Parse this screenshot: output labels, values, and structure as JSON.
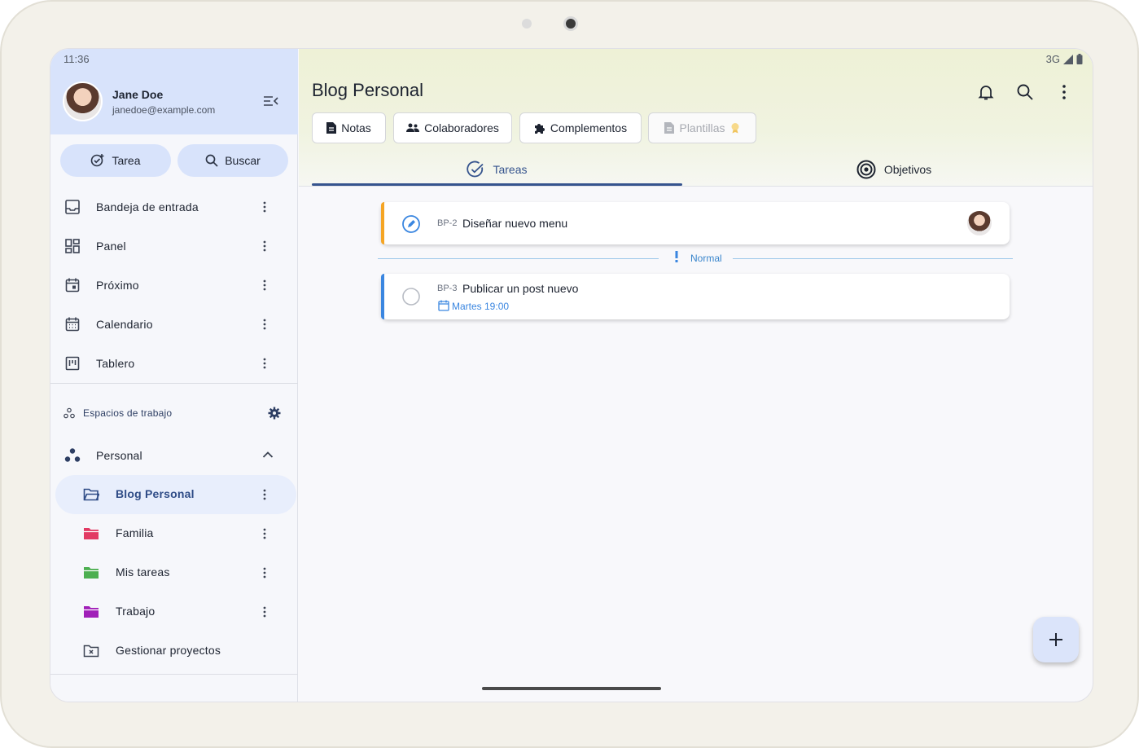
{
  "status": {
    "time": "11:36",
    "network": "3G"
  },
  "user": {
    "name": "Jane Doe",
    "email": "janedoe@example.com"
  },
  "actions": {
    "task_label": "Tarea",
    "search_label": "Buscar"
  },
  "nav": [
    {
      "label": "Bandeja de entrada",
      "icon": "inbox-icon"
    },
    {
      "label": "Panel",
      "icon": "dashboard-icon"
    },
    {
      "label": "Próximo",
      "icon": "calendar-today-icon"
    },
    {
      "label": "Calendario",
      "icon": "calendar-month-icon"
    },
    {
      "label": "Tablero",
      "icon": "board-icon"
    }
  ],
  "workspaces": {
    "header": "Espacios de trabajo",
    "group": "Personal",
    "items": [
      {
        "label": "Blog Personal",
        "color": "#2e4b86",
        "active": true
      },
      {
        "label": "Familia",
        "color": "#e23a63"
      },
      {
        "label": "Mis tareas",
        "color": "#4caf50"
      },
      {
        "label": "Trabajo",
        "color": "#a01fb8"
      }
    ],
    "manage": "Gestionar proyectos"
  },
  "main": {
    "title": "Blog Personal",
    "chips": [
      {
        "label": "Notas",
        "icon": "document-icon"
      },
      {
        "label": "Colaboradores",
        "icon": "people-icon"
      },
      {
        "label": "Complementos",
        "icon": "puzzle-icon"
      },
      {
        "label": "Plantillas",
        "icon": "template-icon",
        "disabled": true
      }
    ],
    "tabs": [
      {
        "label": "Tareas",
        "active": true
      },
      {
        "label": "Objetivos"
      }
    ],
    "tasks_in_progress": [
      {
        "code": "BP-2",
        "title": "Diseñar nuevo menu",
        "accent": "#f5a524"
      }
    ],
    "group_label": "Normal",
    "tasks_normal": [
      {
        "code": "BP-3",
        "title": "Publicar un post nuevo",
        "due": "Martes 19:00",
        "accent": "#3a86e0"
      }
    ]
  },
  "colors": {
    "accent": "#36548e",
    "sidebar_top": "#d8e3fb",
    "header": "#eef1d6"
  }
}
